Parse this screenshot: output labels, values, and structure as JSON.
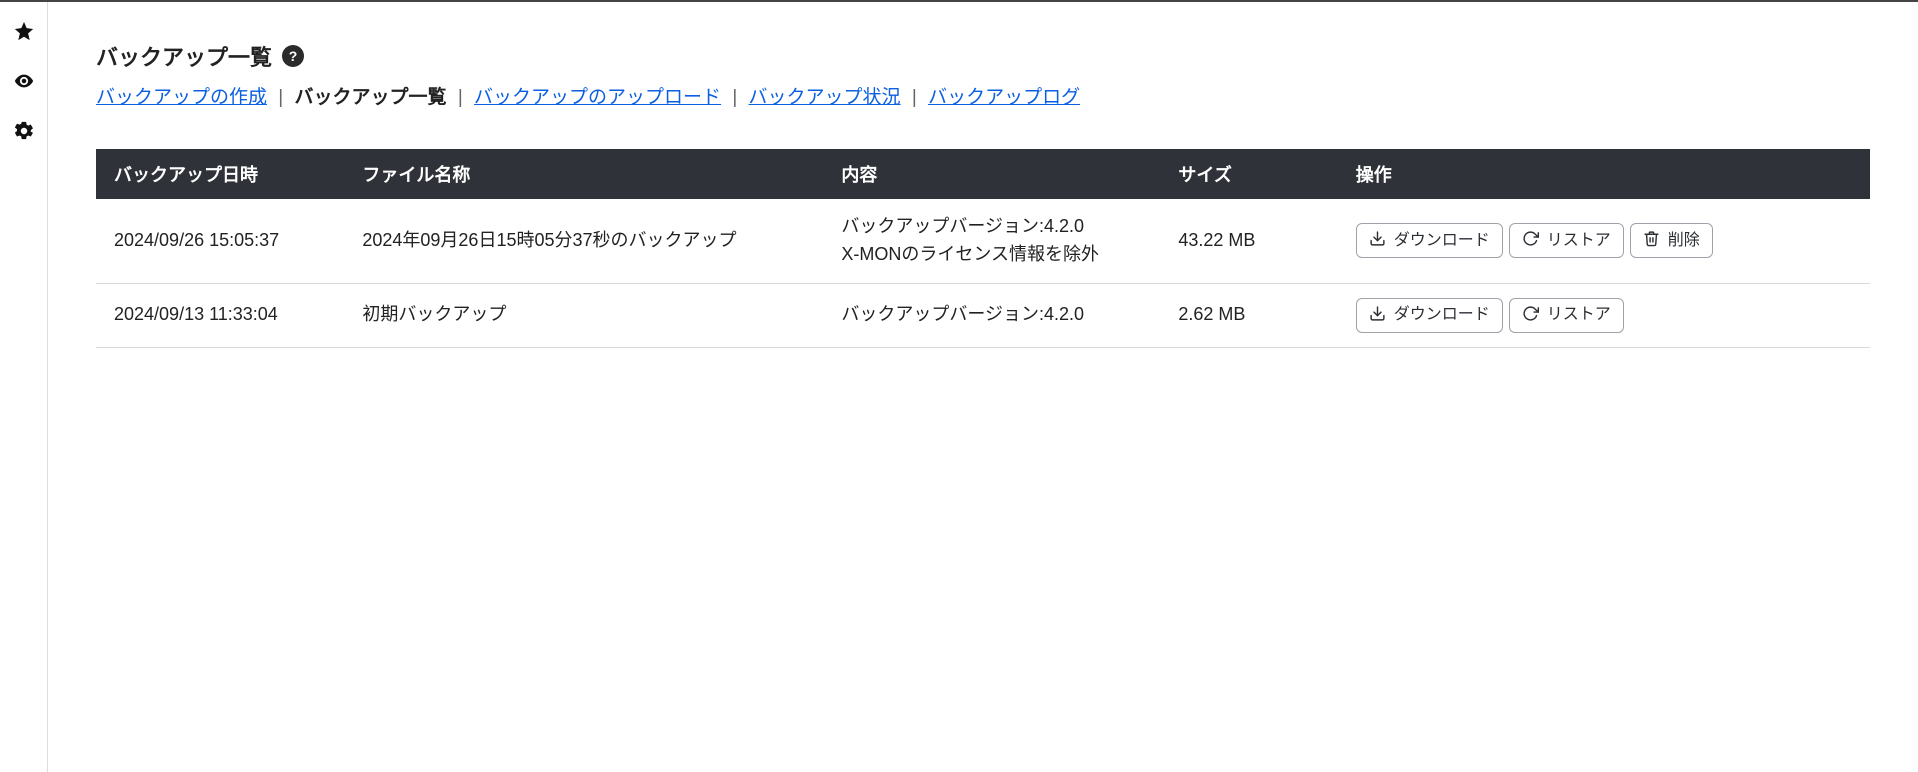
{
  "page": {
    "title": "バックアップ一覧"
  },
  "subnav": {
    "create": "バックアップの作成",
    "list": "バックアップ一覧",
    "upload": "バックアップのアップロード",
    "status": "バックアップ状況",
    "log": "バックアップログ",
    "sep": "|"
  },
  "table": {
    "headers": {
      "datetime": "バックアップ日時",
      "filename": "ファイル名称",
      "content": "内容",
      "size": "サイズ",
      "ops": "操作"
    },
    "rows": [
      {
        "datetime": "2024/09/26 15:05:37",
        "filename": "2024年09月26日15時05分37秒のバックアップ",
        "content_line1": "バックアップバージョン:4.2.0",
        "content_line2": "X-MONのライセンス情報を除外",
        "size": "43.22 MB",
        "has_delete": true
      },
      {
        "datetime": "2024/09/13 11:33:04",
        "filename": "初期バックアップ",
        "content_line1": "バックアップバージョン:4.2.0",
        "content_line2": "",
        "size": "2.62 MB",
        "has_delete": false
      }
    ]
  },
  "buttons": {
    "download": "ダウンロード",
    "restore": "リストア",
    "delete": "削除"
  }
}
